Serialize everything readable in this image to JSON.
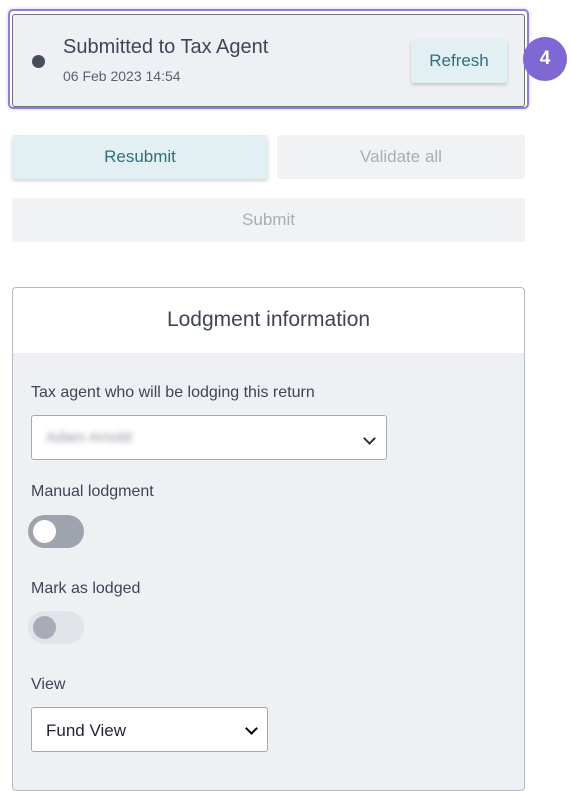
{
  "status": {
    "title": "Submitted to Tax Agent",
    "timestamp": "06 Feb 2023 14:54",
    "refresh_label": "Refresh",
    "step_number": "4"
  },
  "actions": {
    "resubmit_label": "Resubmit",
    "validate_all_label": "Validate all",
    "submit_label": "Submit"
  },
  "lodgment": {
    "title": "Lodgment information",
    "tax_agent_label": "Tax agent who will be lodging this return",
    "tax_agent_value": "Adam Arnold",
    "manual_lodgment_label": "Manual lodgment",
    "manual_lodgment_on": false,
    "mark_as_lodged_label": "Mark as lodged",
    "mark_as_lodged_on": false,
    "view_label": "View",
    "view_value": "Fund View"
  },
  "colors": {
    "accent": "#7f67d4",
    "primary_button_bg": "#e3f0f3",
    "primary_button_text": "#2e6f80",
    "disabled_button_bg": "#f1f2f4",
    "panel_bg": "#eef0f4"
  }
}
